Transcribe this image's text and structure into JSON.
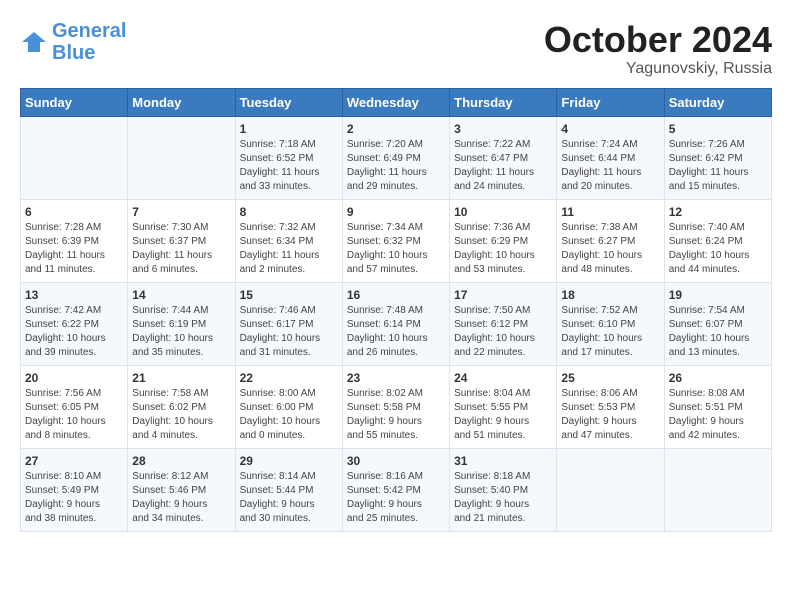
{
  "header": {
    "logo_line1": "General",
    "logo_line2": "Blue",
    "title": "October 2024",
    "subtitle": "Yagunovskiy, Russia"
  },
  "weekdays": [
    "Sunday",
    "Monday",
    "Tuesday",
    "Wednesday",
    "Thursday",
    "Friday",
    "Saturday"
  ],
  "weeks": [
    [
      {
        "day": "",
        "lines": []
      },
      {
        "day": "",
        "lines": []
      },
      {
        "day": "1",
        "lines": [
          "Sunrise: 7:18 AM",
          "Sunset: 6:52 PM",
          "Daylight: 11 hours",
          "and 33 minutes."
        ]
      },
      {
        "day": "2",
        "lines": [
          "Sunrise: 7:20 AM",
          "Sunset: 6:49 PM",
          "Daylight: 11 hours",
          "and 29 minutes."
        ]
      },
      {
        "day": "3",
        "lines": [
          "Sunrise: 7:22 AM",
          "Sunset: 6:47 PM",
          "Daylight: 11 hours",
          "and 24 minutes."
        ]
      },
      {
        "day": "4",
        "lines": [
          "Sunrise: 7:24 AM",
          "Sunset: 6:44 PM",
          "Daylight: 11 hours",
          "and 20 minutes."
        ]
      },
      {
        "day": "5",
        "lines": [
          "Sunrise: 7:26 AM",
          "Sunset: 6:42 PM",
          "Daylight: 11 hours",
          "and 15 minutes."
        ]
      }
    ],
    [
      {
        "day": "6",
        "lines": [
          "Sunrise: 7:28 AM",
          "Sunset: 6:39 PM",
          "Daylight: 11 hours",
          "and 11 minutes."
        ]
      },
      {
        "day": "7",
        "lines": [
          "Sunrise: 7:30 AM",
          "Sunset: 6:37 PM",
          "Daylight: 11 hours",
          "and 6 minutes."
        ]
      },
      {
        "day": "8",
        "lines": [
          "Sunrise: 7:32 AM",
          "Sunset: 6:34 PM",
          "Daylight: 11 hours",
          "and 2 minutes."
        ]
      },
      {
        "day": "9",
        "lines": [
          "Sunrise: 7:34 AM",
          "Sunset: 6:32 PM",
          "Daylight: 10 hours",
          "and 57 minutes."
        ]
      },
      {
        "day": "10",
        "lines": [
          "Sunrise: 7:36 AM",
          "Sunset: 6:29 PM",
          "Daylight: 10 hours",
          "and 53 minutes."
        ]
      },
      {
        "day": "11",
        "lines": [
          "Sunrise: 7:38 AM",
          "Sunset: 6:27 PM",
          "Daylight: 10 hours",
          "and 48 minutes."
        ]
      },
      {
        "day": "12",
        "lines": [
          "Sunrise: 7:40 AM",
          "Sunset: 6:24 PM",
          "Daylight: 10 hours",
          "and 44 minutes."
        ]
      }
    ],
    [
      {
        "day": "13",
        "lines": [
          "Sunrise: 7:42 AM",
          "Sunset: 6:22 PM",
          "Daylight: 10 hours",
          "and 39 minutes."
        ]
      },
      {
        "day": "14",
        "lines": [
          "Sunrise: 7:44 AM",
          "Sunset: 6:19 PM",
          "Daylight: 10 hours",
          "and 35 minutes."
        ]
      },
      {
        "day": "15",
        "lines": [
          "Sunrise: 7:46 AM",
          "Sunset: 6:17 PM",
          "Daylight: 10 hours",
          "and 31 minutes."
        ]
      },
      {
        "day": "16",
        "lines": [
          "Sunrise: 7:48 AM",
          "Sunset: 6:14 PM",
          "Daylight: 10 hours",
          "and 26 minutes."
        ]
      },
      {
        "day": "17",
        "lines": [
          "Sunrise: 7:50 AM",
          "Sunset: 6:12 PM",
          "Daylight: 10 hours",
          "and 22 minutes."
        ]
      },
      {
        "day": "18",
        "lines": [
          "Sunrise: 7:52 AM",
          "Sunset: 6:10 PM",
          "Daylight: 10 hours",
          "and 17 minutes."
        ]
      },
      {
        "day": "19",
        "lines": [
          "Sunrise: 7:54 AM",
          "Sunset: 6:07 PM",
          "Daylight: 10 hours",
          "and 13 minutes."
        ]
      }
    ],
    [
      {
        "day": "20",
        "lines": [
          "Sunrise: 7:56 AM",
          "Sunset: 6:05 PM",
          "Daylight: 10 hours",
          "and 8 minutes."
        ]
      },
      {
        "day": "21",
        "lines": [
          "Sunrise: 7:58 AM",
          "Sunset: 6:02 PM",
          "Daylight: 10 hours",
          "and 4 minutes."
        ]
      },
      {
        "day": "22",
        "lines": [
          "Sunrise: 8:00 AM",
          "Sunset: 6:00 PM",
          "Daylight: 10 hours",
          "and 0 minutes."
        ]
      },
      {
        "day": "23",
        "lines": [
          "Sunrise: 8:02 AM",
          "Sunset: 5:58 PM",
          "Daylight: 9 hours",
          "and 55 minutes."
        ]
      },
      {
        "day": "24",
        "lines": [
          "Sunrise: 8:04 AM",
          "Sunset: 5:55 PM",
          "Daylight: 9 hours",
          "and 51 minutes."
        ]
      },
      {
        "day": "25",
        "lines": [
          "Sunrise: 8:06 AM",
          "Sunset: 5:53 PM",
          "Daylight: 9 hours",
          "and 47 minutes."
        ]
      },
      {
        "day": "26",
        "lines": [
          "Sunrise: 8:08 AM",
          "Sunset: 5:51 PM",
          "Daylight: 9 hours",
          "and 42 minutes."
        ]
      }
    ],
    [
      {
        "day": "27",
        "lines": [
          "Sunrise: 8:10 AM",
          "Sunset: 5:49 PM",
          "Daylight: 9 hours",
          "and 38 minutes."
        ]
      },
      {
        "day": "28",
        "lines": [
          "Sunrise: 8:12 AM",
          "Sunset: 5:46 PM",
          "Daylight: 9 hours",
          "and 34 minutes."
        ]
      },
      {
        "day": "29",
        "lines": [
          "Sunrise: 8:14 AM",
          "Sunset: 5:44 PM",
          "Daylight: 9 hours",
          "and 30 minutes."
        ]
      },
      {
        "day": "30",
        "lines": [
          "Sunrise: 8:16 AM",
          "Sunset: 5:42 PM",
          "Daylight: 9 hours",
          "and 25 minutes."
        ]
      },
      {
        "day": "31",
        "lines": [
          "Sunrise: 8:18 AM",
          "Sunset: 5:40 PM",
          "Daylight: 9 hours",
          "and 21 minutes."
        ]
      },
      {
        "day": "",
        "lines": []
      },
      {
        "day": "",
        "lines": []
      }
    ]
  ]
}
